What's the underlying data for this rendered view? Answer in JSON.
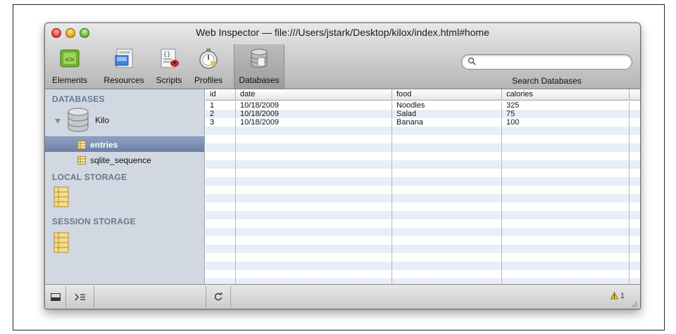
{
  "window": {
    "title": "Web Inspector — file:///Users/jstark/Desktop/kilox/index.html#home"
  },
  "toolbar": {
    "items": [
      {
        "label": "Elements",
        "icon": "elements-icon"
      },
      {
        "label": "Resources",
        "icon": "resources-icon"
      },
      {
        "label": "Scripts",
        "icon": "scripts-icon"
      },
      {
        "label": "Profiles",
        "icon": "profiles-icon"
      },
      {
        "label": "Databases",
        "icon": "databases-icon",
        "active": true
      }
    ],
    "search_placeholder": "",
    "search_label": "Search Databases"
  },
  "sidebar": {
    "databases_header": "DATABASES",
    "database_name": "Kilo",
    "tables": [
      {
        "label": "entries",
        "selected": true
      },
      {
        "label": "sqlite_sequence",
        "selected": false
      }
    ],
    "local_storage_header": "LOCAL STORAGE",
    "session_storage_header": "SESSION STORAGE"
  },
  "table": {
    "columns": [
      "id",
      "date",
      "food",
      "calories"
    ],
    "rows": [
      [
        "1",
        "10/18/2009",
        "Noodles",
        "325"
      ],
      [
        "2",
        "10/18/2009",
        "Salad",
        "75"
      ],
      [
        "3",
        "10/18/2009",
        "Banana",
        "100"
      ]
    ]
  },
  "statusbar": {
    "warning_count": "1"
  },
  "colors": {
    "sidebar_bg": "#d1d8e2",
    "section_header": "#68788a",
    "selection": "#7a8fb3",
    "stripe": "#e8eef7"
  }
}
